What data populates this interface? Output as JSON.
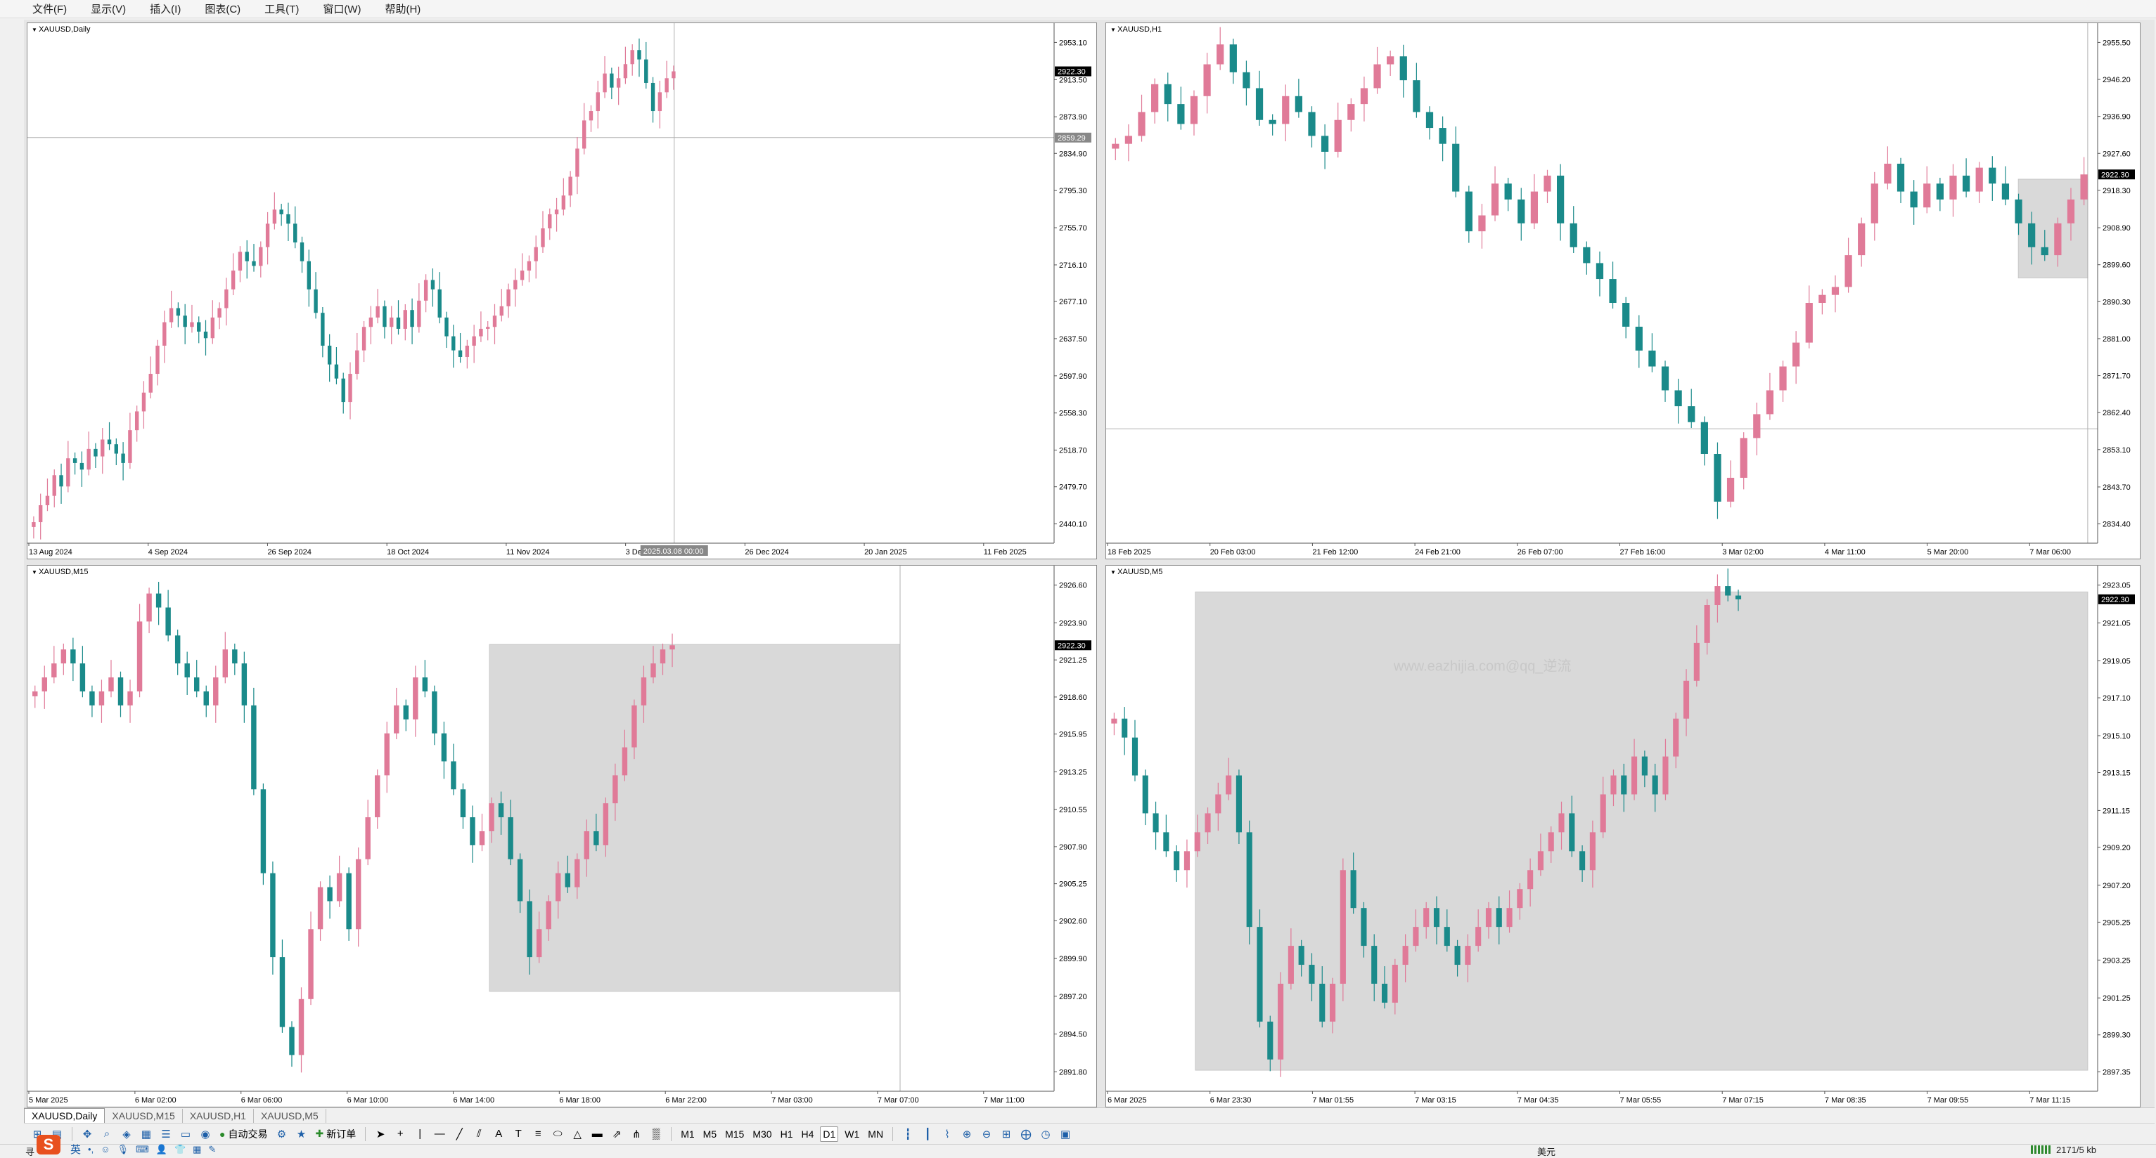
{
  "menu": [
    "文件(F)",
    "显示(V)",
    "插入(I)",
    "图表(C)",
    "工具(T)",
    "窗口(W)",
    "帮助(H)"
  ],
  "charts": [
    {
      "id": "daily",
      "title": "XAUUSD,Daily",
      "price_tag": "2922.30",
      "crosshair_price": "2859.29",
      "crosshair_time": "2025.03.08 00:00",
      "yticks": [
        "2953.10",
        "2913.50",
        "2873.90",
        "2834.90",
        "2795.30",
        "2755.70",
        "2716.10",
        "2677.10",
        "2637.50",
        "2597.90",
        "2558.30",
        "2518.70",
        "2479.70",
        "2440.10"
      ],
      "xticks": [
        "13 Aug 2024",
        "4 Sep 2024",
        "26 Sep 2024",
        "18 Oct 2024",
        "11 Nov 2024",
        "3 Dec 2024",
        "26 Dec 2024",
        "20 Jan 2025",
        "11 Feb 2025"
      ],
      "series": [
        2442,
        2460,
        2470,
        2492,
        2480,
        2510,
        2505,
        2498,
        2520,
        2512,
        2530,
        2525,
        2515,
        2505,
        2540,
        2560,
        2580,
        2600,
        2630,
        2655,
        2670,
        2662,
        2650,
        2655,
        2645,
        2638,
        2660,
        2670,
        2690,
        2710,
        2730,
        2720,
        2715,
        2735,
        2760,
        2775,
        2770,
        2760,
        2740,
        2720,
        2690,
        2665,
        2630,
        2610,
        2595,
        2570,
        2600,
        2625,
        2650,
        2660,
        2672,
        2650,
        2660,
        2648,
        2668,
        2650,
        2678,
        2700,
        2690,
        2660,
        2640,
        2625,
        2618,
        2630,
        2640,
        2648,
        2650,
        2662,
        2672,
        2690,
        2700,
        2710,
        2720,
        2735,
        2755,
        2770,
        2775,
        2790,
        2810,
        2840,
        2870,
        2880,
        2900,
        2920,
        2905,
        2915,
        2930,
        2945,
        2935,
        2910,
        2880,
        2900,
        2915,
        2922.3
      ]
    },
    {
      "id": "h1",
      "title": "XAUUSD,H1",
      "price_tag": "2922.30",
      "yticks": [
        "2955.50",
        "2946.20",
        "2936.90",
        "2927.60",
        "2918.30",
        "2908.90",
        "2899.60",
        "2890.30",
        "2881.00",
        "2871.70",
        "2862.40",
        "2853.10",
        "2843.70",
        "2834.40"
      ],
      "xticks": [
        "18 Feb 2025",
        "20 Feb 03:00",
        "21 Feb 12:00",
        "24 Feb 21:00",
        "26 Feb 07:00",
        "27 Feb 16:00",
        "3 Mar 02:00",
        "4 Mar 11:00",
        "5 Mar 20:00",
        "7 Mar 06:00"
      ],
      "series": [
        2930,
        2932,
        2938,
        2945,
        2940,
        2935,
        2942,
        2950,
        2955,
        2948,
        2944,
        2936,
        2935,
        2942,
        2938,
        2932,
        2928,
        2936,
        2940,
        2944,
        2950,
        2952,
        2946,
        2938,
        2934,
        2930,
        2918,
        2908,
        2912,
        2920,
        2916,
        2910,
        2918,
        2922,
        2910,
        2904,
        2900,
        2896,
        2890,
        2884,
        2878,
        2874,
        2868,
        2864,
        2860,
        2852,
        2840,
        2846,
        2856,
        2862,
        2868,
        2874,
        2880,
        2890,
        2892,
        2894,
        2902,
        2910,
        2920,
        2925,
        2918,
        2914,
        2920,
        2916,
        2922,
        2918,
        2924,
        2920,
        2916,
        2910,
        2904,
        2902,
        2910,
        2916,
        2922.3
      ]
    },
    {
      "id": "m15",
      "title": "XAUUSD,M15",
      "price_tag": "2922.30",
      "yticks": [
        "2926.60",
        "2923.90",
        "2921.25",
        "2918.60",
        "2915.95",
        "2913.25",
        "2910.55",
        "2907.90",
        "2905.25",
        "2902.60",
        "2899.90",
        "2897.20",
        "2894.50",
        "2891.80"
      ],
      "xticks": [
        "5 Mar 2025",
        "6 Mar 02:00",
        "6 Mar 06:00",
        "6 Mar 10:00",
        "6 Mar 14:00",
        "6 Mar 18:00",
        "6 Mar 22:00",
        "7 Mar 03:00",
        "7 Mar 07:00",
        "7 Mar 11:00"
      ],
      "series": [
        2919,
        2920,
        2921,
        2922,
        2921,
        2919,
        2918,
        2919,
        2920,
        2918,
        2919,
        2924,
        2926,
        2925,
        2923,
        2921,
        2920,
        2919,
        2918,
        2920,
        2922,
        2921,
        2918,
        2912,
        2906,
        2900,
        2895,
        2893,
        2897,
        2902,
        2905,
        2904,
        2906,
        2902,
        2907,
        2910,
        2913,
        2916,
        2918,
        2917,
        2920,
        2919,
        2916,
        2914,
        2912,
        2910,
        2908,
        2909,
        2911,
        2910,
        2907,
        2904,
        2900,
        2902,
        2904,
        2906,
        2905,
        2907,
        2909,
        2908,
        2911,
        2913,
        2915,
        2918,
        2920,
        2921,
        2922,
        2922.3
      ]
    },
    {
      "id": "m5",
      "title": "XAUUSD,M5",
      "price_tag": "2922.30",
      "watermark": "www.eazhijia.com@qq_逆流",
      "yticks": [
        "2923.05",
        "2921.05",
        "2919.05",
        "2917.10",
        "2915.10",
        "2913.15",
        "2911.15",
        "2909.20",
        "2907.20",
        "2905.25",
        "2903.25",
        "2901.25",
        "2899.30",
        "2897.35"
      ],
      "xticks": [
        "6 Mar 2025",
        "6 Mar 23:30",
        "7 Mar 01:55",
        "7 Mar 03:15",
        "7 Mar 04:35",
        "7 Mar 05:55",
        "7 Mar 07:15",
        "7 Mar 08:35",
        "7 Mar 09:55",
        "7 Mar 11:15"
      ],
      "series": [
        2916,
        2915,
        2913,
        2911,
        2910,
        2909,
        2908,
        2909,
        2910,
        2911,
        2912,
        2913,
        2910,
        2905,
        2900,
        2898,
        2902,
        2904,
        2903,
        2902,
        2900,
        2902,
        2908,
        2906,
        2904,
        2902,
        2901,
        2903,
        2904,
        2905,
        2906,
        2905,
        2904,
        2903,
        2904,
        2905,
        2906,
        2905,
        2906,
        2907,
        2908,
        2909,
        2910,
        2911,
        2909,
        2908,
        2910,
        2912,
        2913,
        2912,
        2914,
        2913,
        2912,
        2914,
        2916,
        2918,
        2920,
        2922,
        2923,
        2922.5,
        2922.3
      ]
    }
  ],
  "tabs": [
    "XAUUSD,Daily",
    "XAUUSD,M15",
    "XAUUSD,H1",
    "XAUUSD,M5"
  ],
  "toolbar": {
    "auto_trade": "自动交易",
    "new_order": "新订单",
    "timeframes": [
      "M1",
      "M5",
      "M15",
      "M30",
      "H1",
      "H4",
      "D1",
      "W1",
      "MN"
    ]
  },
  "status": {
    "currency": "美元",
    "traffic": "2171/5 kb",
    "ime": "英",
    "left_label": "寻"
  }
}
